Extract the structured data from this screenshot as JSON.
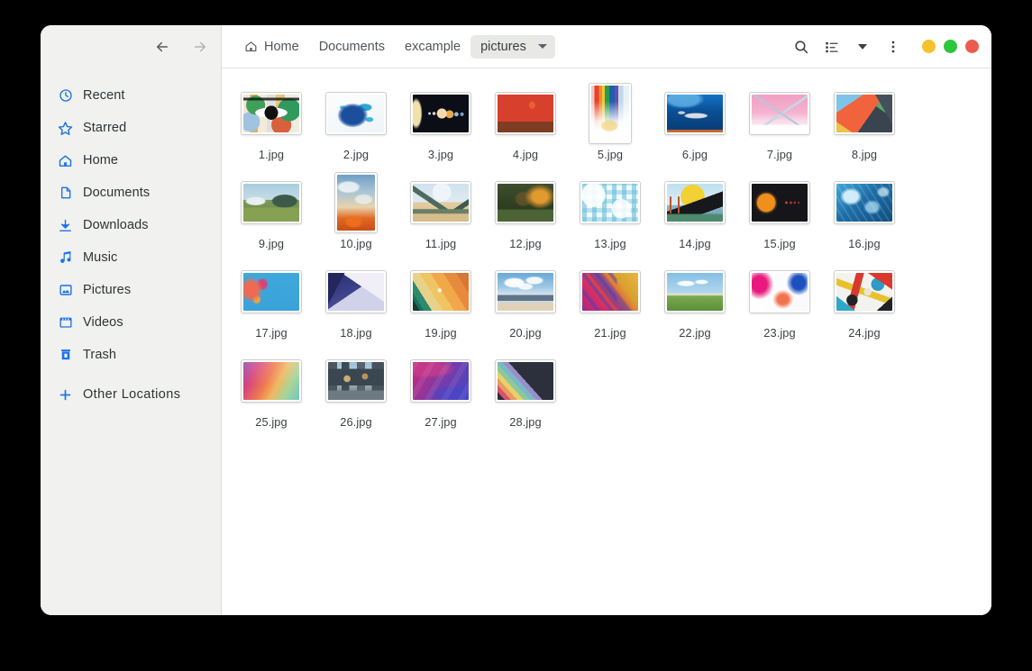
{
  "window": {
    "controls": [
      {
        "name": "minimize",
        "color": "#f5c22b"
      },
      {
        "name": "maximize",
        "color": "#2cc63c"
      },
      {
        "name": "close",
        "color": "#ec5c4e"
      }
    ]
  },
  "sidebar": {
    "back_label": "Back",
    "forward_label": "Forward",
    "items": [
      {
        "label": "Recent",
        "icon": "clock-icon"
      },
      {
        "label": "Starred",
        "icon": "star-icon"
      },
      {
        "label": "Home",
        "icon": "home-icon"
      },
      {
        "label": "Documents",
        "icon": "document-icon"
      },
      {
        "label": "Downloads",
        "icon": "download-icon"
      },
      {
        "label": "Music",
        "icon": "music-note-icon"
      },
      {
        "label": "Pictures",
        "icon": "image-icon"
      },
      {
        "label": "Videos",
        "icon": "video-icon"
      },
      {
        "label": "Trash",
        "icon": "trash-icon"
      }
    ],
    "other_locations": {
      "label": "Other  Locations",
      "icon": "plus-icon"
    }
  },
  "toolbar": {
    "breadcrumb": [
      {
        "label": "Home",
        "icon": "home-icon",
        "current": false
      },
      {
        "label": "Documents",
        "icon": "",
        "current": false
      },
      {
        "label": "excample",
        "icon": "",
        "current": false
      },
      {
        "label": "pictures",
        "icon": "",
        "current": true
      }
    ],
    "search_label": "Search",
    "view_list_label": "List view",
    "view_options_label": "View options",
    "menu_label": "Main menu"
  },
  "files": [
    {
      "name": "1.jpg",
      "orientation": "landscape",
      "art": "collage-eye"
    },
    {
      "name": "2.jpg",
      "orientation": "landscape",
      "art": "blue-splash"
    },
    {
      "name": "3.jpg",
      "orientation": "landscape",
      "art": "solar-system"
    },
    {
      "name": "4.jpg",
      "orientation": "landscape",
      "art": "balloons-canyon"
    },
    {
      "name": "5.jpg",
      "orientation": "portrait",
      "art": "rainbow-drip"
    },
    {
      "name": "6.jpg",
      "orientation": "landscape",
      "art": "whale-ocean"
    },
    {
      "name": "7.jpg",
      "orientation": "landscape",
      "art": "pink-mountains"
    },
    {
      "name": "8.jpg",
      "orientation": "landscape",
      "art": "geometric-shapes"
    },
    {
      "name": "9.jpg",
      "orientation": "landscape",
      "art": "green-hills"
    },
    {
      "name": "10.jpg",
      "orientation": "portrait",
      "art": "fire-sky"
    },
    {
      "name": "11.jpg",
      "orientation": "landscape",
      "art": "desert-peaks"
    },
    {
      "name": "12.jpg",
      "orientation": "landscape",
      "art": "dark-forest"
    },
    {
      "name": "13.jpg",
      "orientation": "landscape",
      "art": "cyan-mosaic"
    },
    {
      "name": "14.jpg",
      "orientation": "landscape",
      "art": "golden-gate-sun"
    },
    {
      "name": "15.jpg",
      "orientation": "landscape",
      "art": "dark-orange-dot"
    },
    {
      "name": "16.jpg",
      "orientation": "landscape",
      "art": "blue-ice"
    },
    {
      "name": "17.jpg",
      "orientation": "landscape",
      "art": "coral-blue"
    },
    {
      "name": "18.jpg",
      "orientation": "landscape",
      "art": "violet-fold"
    },
    {
      "name": "19.jpg",
      "orientation": "landscape",
      "art": "diagonal-warm"
    },
    {
      "name": "20.jpg",
      "orientation": "landscape",
      "art": "harbor-clouds"
    },
    {
      "name": "21.jpg",
      "orientation": "landscape",
      "art": "magenta-streaks"
    },
    {
      "name": "22.jpg",
      "orientation": "landscape",
      "art": "field-sky"
    },
    {
      "name": "23.jpg",
      "orientation": "landscape",
      "art": "pink-blue-blur"
    },
    {
      "name": "24.jpg",
      "orientation": "landscape",
      "art": "cubist-collage"
    },
    {
      "name": "25.jpg",
      "orientation": "landscape",
      "art": "pastel-gradient"
    },
    {
      "name": "26.jpg",
      "orientation": "landscape",
      "art": "city-street"
    },
    {
      "name": "27.jpg",
      "orientation": "landscape",
      "art": "purple-waves"
    },
    {
      "name": "28.jpg",
      "orientation": "landscape",
      "art": "dark-rainbow-stripe"
    }
  ]
}
